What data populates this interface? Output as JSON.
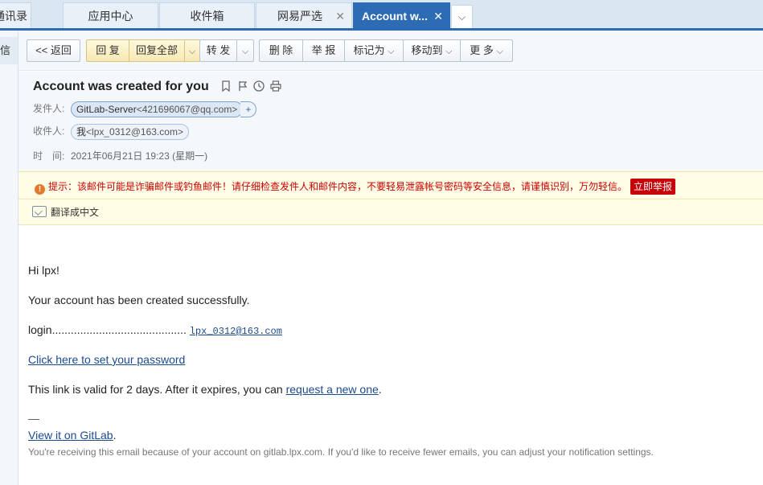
{
  "tabs": [
    {
      "label": "通讯录",
      "closable": false
    },
    {
      "label": "应用中心",
      "closable": false
    },
    {
      "label": "收件箱",
      "closable": false
    },
    {
      "label": "网易严选",
      "closable": true
    },
    {
      "label": "Account w...",
      "closable": true,
      "active": true
    }
  ],
  "tab_more_glyph": "⌵",
  "sidebar": {
    "sliver_text": "信"
  },
  "toolbar": {
    "back": "<< 返回",
    "reply": "回 复",
    "reply_all": "回复全部",
    "forward": "转 发",
    "delete": "删 除",
    "report": "举 报",
    "mark_as": "标记为",
    "move_to": "移动到",
    "more": "更 多",
    "caret": "⌵"
  },
  "email": {
    "subject": "Account was created for you",
    "sender_label": "发件人:",
    "sender_name": "GitLab-Server",
    "sender_addr": "<421696067@qq.com>",
    "add_glyph": "+",
    "recipient_label": "收件人:",
    "recipient_name": "我",
    "recipient_addr": "<lpx_0312@163.com>",
    "time_label": "时　间:",
    "time_value": "2021年06月21日 19:23 (星期一)"
  },
  "header_icons": [
    "bookmark-icon",
    "flag-icon",
    "clock-icon",
    "print-icon"
  ],
  "warning": {
    "text": "提示：该邮件可能是诈骗邮件或钓鱼邮件！请仔细检查发件人和邮件内容，不要轻易泄露帐号密码等安全信息，请谨慎识别，万勿轻信。",
    "report_button": "立即举报",
    "translate": "翻译成中文",
    "icon_glyph": "!"
  },
  "body": {
    "greeting": "Hi lpx!",
    "line1": "Your account has been created successfully.",
    "login_label": "login...........................................",
    "login_value": "lpx_0312@163.com",
    "set_password_link": "Click here to set your password",
    "valid_text": "This link is valid for 2 days. After it expires, you can ",
    "request_link": "request a new one",
    "valid_end": ".",
    "dash": "—",
    "gitlab_link": "View it on GitLab",
    "gitlab_end": ".",
    "footer": "You're receiving this email because of your account on gitlab.lpx.com. If you'd like to receive fewer emails, you can adjust your notification settings."
  },
  "colors": {
    "accent": "#2d6bb5",
    "warning_text": "#cc0000",
    "report_red": "#c8000a",
    "link": "#1c4a8e"
  }
}
